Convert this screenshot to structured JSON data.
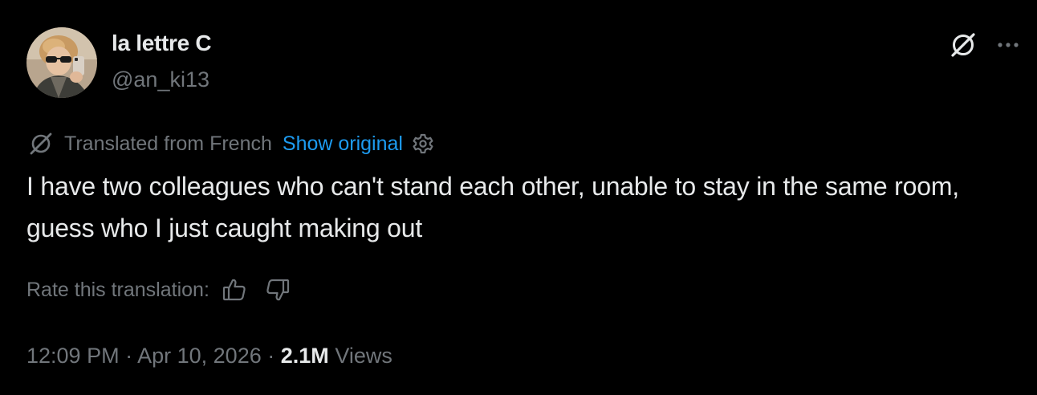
{
  "colors": {
    "background": "#000000",
    "primary_text": "#e7e9ea",
    "secondary_text": "#71767b",
    "link": "#1d9bf0"
  },
  "author": {
    "display_name": "la lettre C",
    "handle": "@an_ki13",
    "avatar_icon": "profile-photo"
  },
  "header_actions": {
    "grok_icon": "grok-icon",
    "more_icon": "more-horizontal-icon"
  },
  "translation": {
    "icon": "grok-icon",
    "label": "Translated from French",
    "show_original": "Show original",
    "settings_icon": "gear-icon"
  },
  "tweet": {
    "text": "I have two colleagues who can't stand each other, unable to stay in the same room, guess who I just caught making out"
  },
  "rate": {
    "label": "Rate this translation:",
    "thumbs_up_icon": "thumbs-up-icon",
    "thumbs_down_icon": "thumbs-down-icon"
  },
  "meta": {
    "time": "12:09 PM",
    "separator": "·",
    "date": "Apr 10, 2026",
    "views_count": "2.1M",
    "views_label": "Views"
  }
}
